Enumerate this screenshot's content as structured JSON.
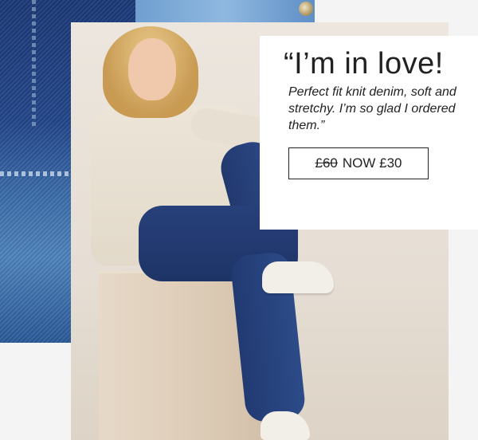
{
  "promo": {
    "quote_title": "“I’m in love!",
    "quote_body": "Perfect fit knit denim, soft and stretchy. I’m so glad I ordered them.”",
    "price": {
      "was": "£60",
      "now": "NOW £30"
    }
  },
  "colors": {
    "denim_dark": "#1c3a78",
    "denim_light": "#8fb8e0",
    "backdrop": "#e6ded4",
    "card_bg": "#ffffff",
    "text": "#222222"
  }
}
